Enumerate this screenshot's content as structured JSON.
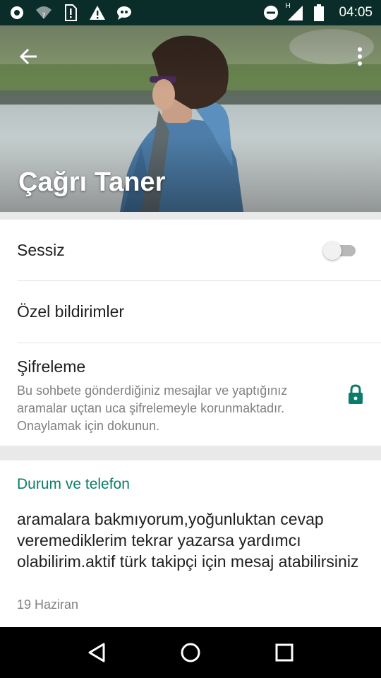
{
  "status_bar": {
    "time": "04:05",
    "network_label": "H",
    "icons": [
      "sync-icon",
      "wifi-question-icon",
      "sim-alert-icon",
      "warning-icon",
      "chat-bubble-icon",
      "do-not-disturb-icon",
      "signal-icon",
      "battery-icon"
    ]
  },
  "header": {
    "contact_name": "Çağrı Taner",
    "back_icon": "arrow-back-icon",
    "menu_icon": "more-vert-icon"
  },
  "settings": {
    "mute_label": "Sessiz",
    "mute_enabled": false,
    "custom_notifications_label": "Özel bildirimler",
    "encryption_title": "Şifreleme",
    "encryption_desc": "Bu sohbete gönderdiğiniz mesajlar ve yaptığınız aramalar uçtan uca şifrelemeyle korunmaktadır. Onaylamak için dokunun.",
    "encryption_icon": "lock-icon"
  },
  "about": {
    "section_title": "Durum ve telefon",
    "status_text": "aramalara bakmıyorum,yoğunluktan cevap veremediklerim tekrar yazarsa yardımcı olabilirim.aktif türk takipçi için mesaj atabilirsiniz",
    "status_date": "19 Haziran"
  },
  "colors": {
    "accent": "#0a7c6a",
    "status_bar": "#0b2d29"
  },
  "nav": [
    "back-triangle-icon",
    "home-circle-icon",
    "recents-square-icon"
  ]
}
